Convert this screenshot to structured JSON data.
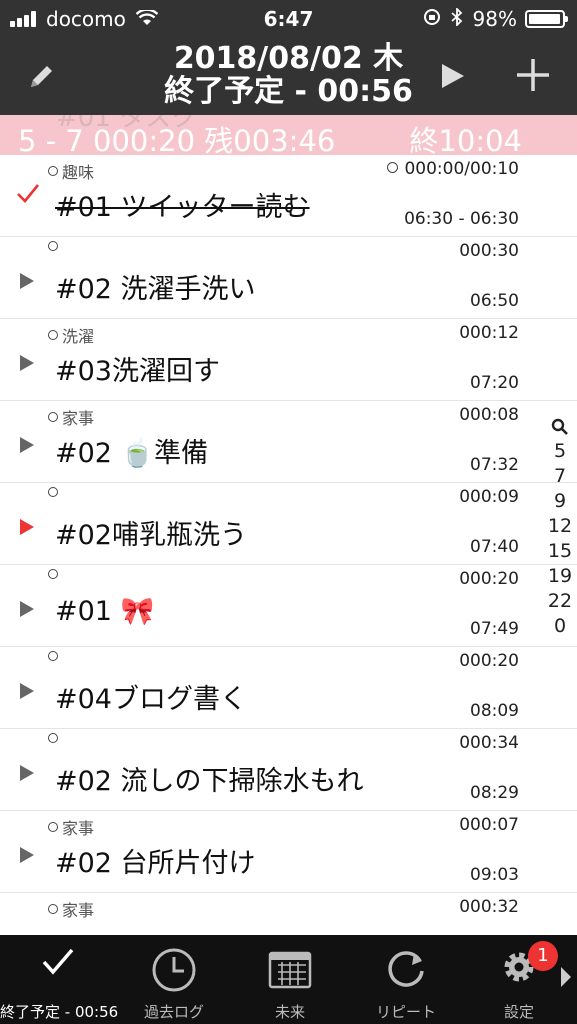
{
  "status_bar": {
    "carrier": "docomo",
    "time": "6:47",
    "battery": "98%"
  },
  "header": {
    "date": "2018/08/02 木",
    "subtitle": "終了予定 - 00:56"
  },
  "banner": {
    "ghost_text": "#01 タスク",
    "text": "5 - 7   000:20 残003:46",
    "end_text": "終10:04",
    "bg_color": "#f6c6cc"
  },
  "tasks": [
    {
      "category": "趣味",
      "duration": "000:00/00:10",
      "title": "#01 ツイッター読む",
      "time": "06:30 - 06:30",
      "state": "done"
    },
    {
      "category": "",
      "duration": "000:30",
      "title": "#02 洗濯手洗い",
      "time": "06:50",
      "state": "play"
    },
    {
      "category": "洗濯",
      "duration": "000:12",
      "title": "#03洗濯回す",
      "time": "07:20",
      "state": "play"
    },
    {
      "category": "家事",
      "duration": "000:08",
      "title": "#02 🍵準備",
      "time": "07:32",
      "state": "play"
    },
    {
      "category": "",
      "duration": "000:09",
      "title": "#02哺乳瓶洗う",
      "time": "07:40",
      "state": "current"
    },
    {
      "category": "",
      "duration": "000:20",
      "title": "#01 🎀",
      "time": "07:49",
      "state": "play"
    },
    {
      "category": "",
      "duration": "000:20",
      "title": "#04ブログ書く",
      "time": "08:09",
      "state": "play"
    },
    {
      "category": "",
      "duration": "000:34",
      "title": "#02 流しの下掃除水もれ",
      "time": "08:29",
      "state": "play"
    },
    {
      "category": "家事",
      "duration": "000:07",
      "title": "#02 台所片付け",
      "time": "09:03",
      "state": "play"
    },
    {
      "category": "家事",
      "duration": "000:32",
      "title": "",
      "time": "",
      "state": "play"
    }
  ],
  "index": [
    "5",
    "7",
    "9",
    "12",
    "15",
    "19",
    "22",
    "0"
  ],
  "tabs": [
    {
      "label": "終了予定 - 00:56",
      "icon": "check-icon"
    },
    {
      "label": "過去ログ",
      "icon": "clock-icon"
    },
    {
      "label": "未来",
      "icon": "calendar-icon"
    },
    {
      "label": "リピート",
      "icon": "repeat-icon"
    },
    {
      "label": "設定",
      "icon": "gear-icon",
      "badge": "1"
    }
  ],
  "colors": {
    "bar_bg": "#333333",
    "tabbar_bg": "#111111",
    "accent_red": "#ee3333"
  }
}
